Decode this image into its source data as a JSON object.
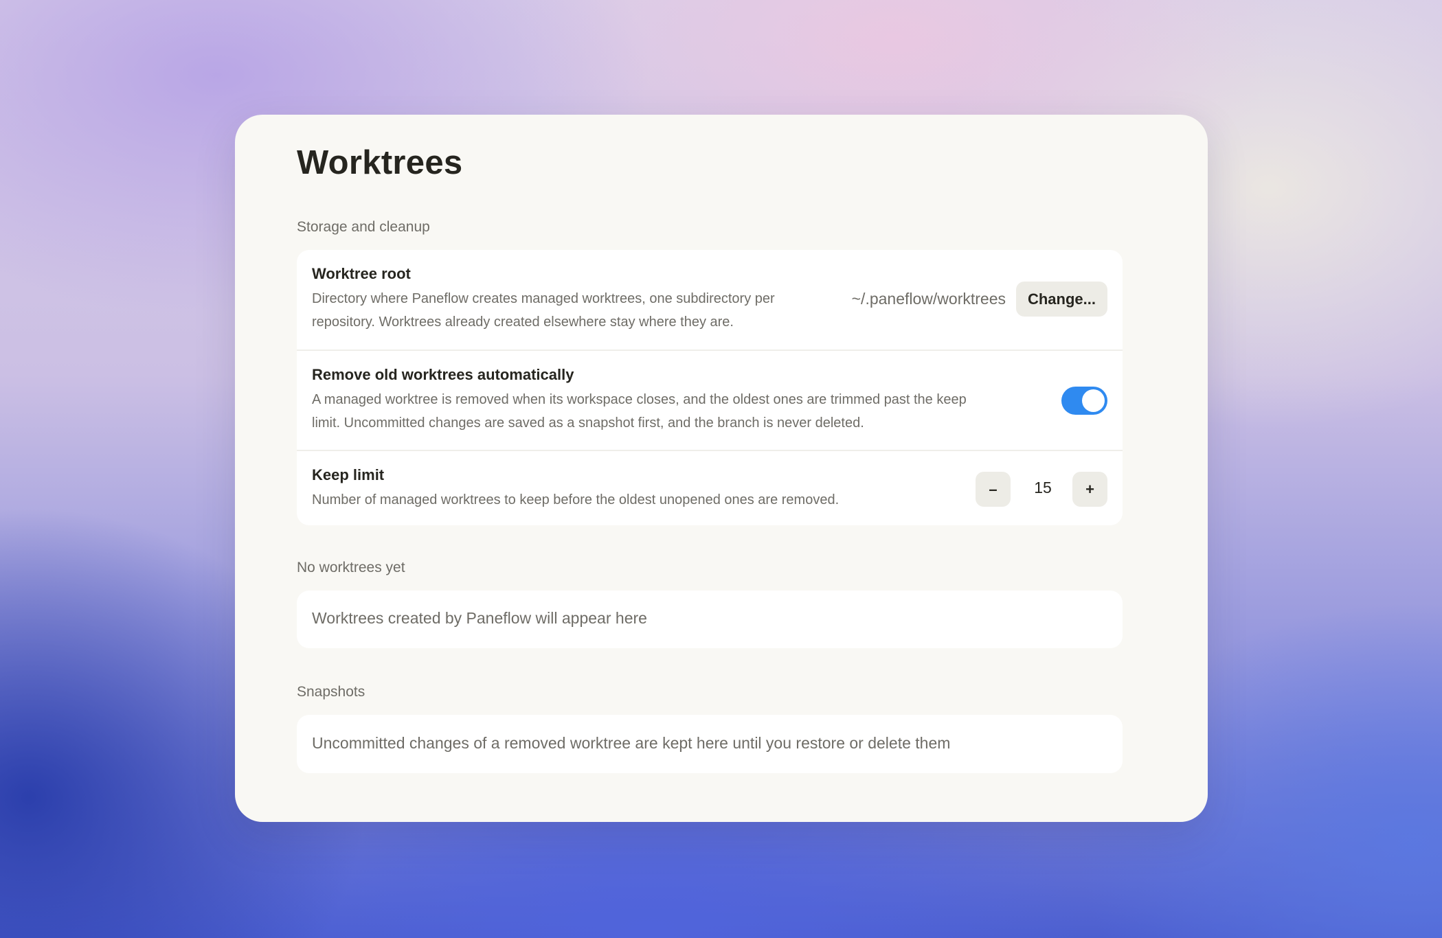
{
  "page": {
    "title": "Worktrees"
  },
  "storage": {
    "section_label": "Storage and cleanup",
    "worktree_root": {
      "title": "Worktree root",
      "description_line1": "Directory where Paneflow creates managed worktrees, one subdirectory per",
      "description_line2": "repository. Worktrees already created elsewhere stay where they are.",
      "path": "~/.paneflow/worktrees",
      "change_label": "Change..."
    },
    "auto_remove": {
      "title": "Remove old worktrees automatically",
      "description_line1": "A managed worktree is removed when its workspace closes, and the oldest ones are trimmed past the keep",
      "description_line2": "limit. Uncommitted changes are saved as a snapshot first, and the branch is never deleted.",
      "enabled": true
    },
    "keep_limit": {
      "title": "Keep limit",
      "description": "Number of managed worktrees to keep before the oldest unopened ones are removed.",
      "decrement_label": "–",
      "value": "15",
      "increment_label": "+"
    }
  },
  "worktrees": {
    "section_label": "No worktrees yet",
    "empty_text": "Worktrees created by Paneflow will appear here"
  },
  "snapshots": {
    "section_label": "Snapshots",
    "empty_text": "Uncommitted changes of a removed worktree are kept here until you restore or delete them"
  },
  "colors": {
    "accent": "#2f8af0",
    "panel_bg": "#f9f8f4",
    "card_bg": "#ffffff",
    "text_primary": "#26251f",
    "text_secondary": "#6e6c66"
  }
}
